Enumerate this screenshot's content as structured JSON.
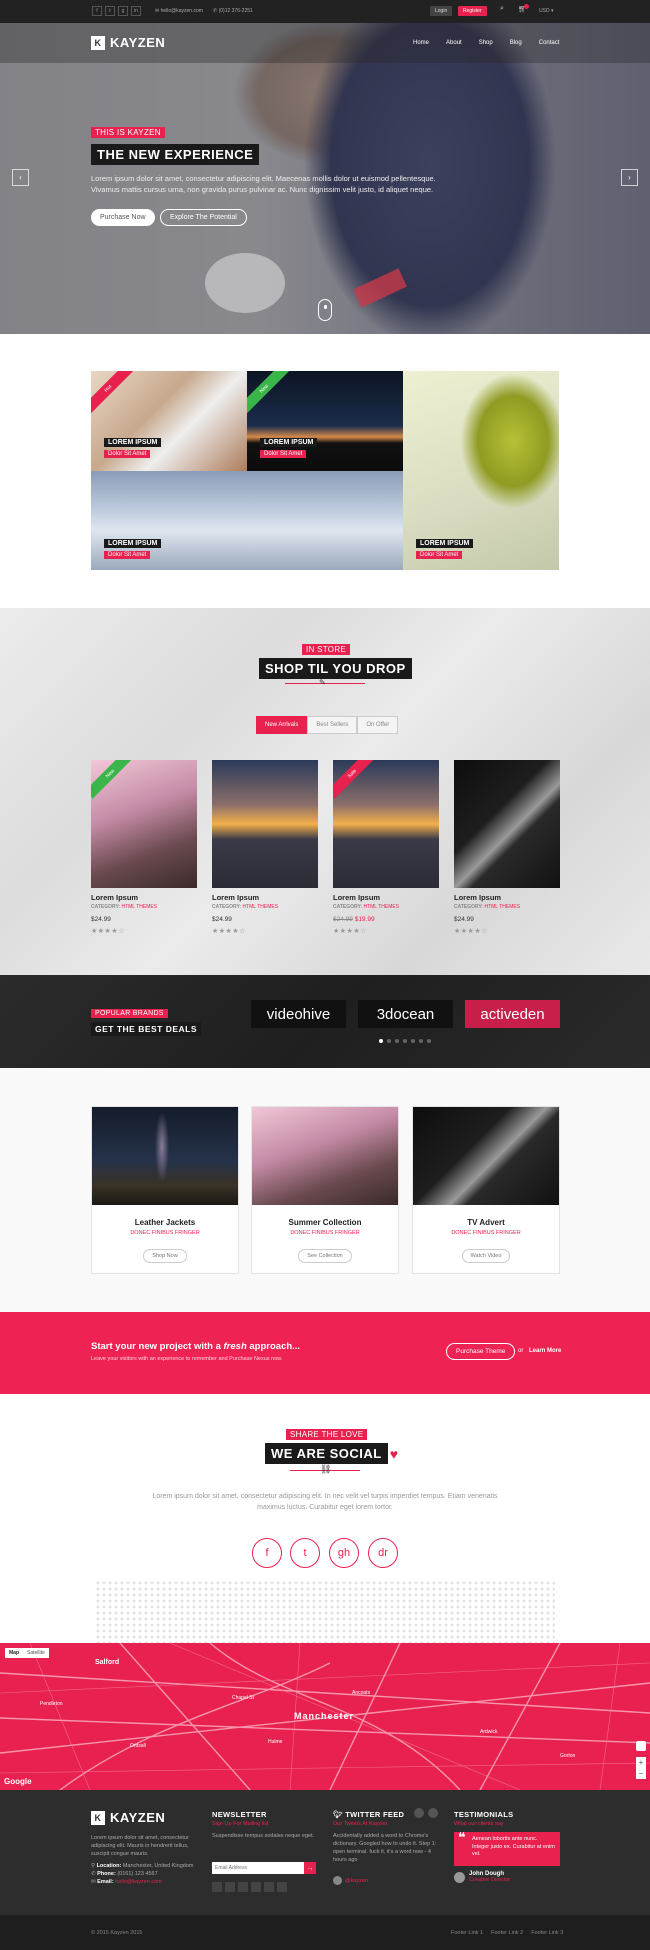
{
  "topbar": {
    "social": [
      "f",
      "t",
      "g",
      "in"
    ],
    "email": "hello@kayzen.com",
    "phone": "(0)12 376-2251",
    "login": "Login",
    "register": "Register",
    "currency": "USD"
  },
  "nav": {
    "logo": "KAYZEN",
    "items": [
      "Home",
      "About",
      "Shop",
      "Blog",
      "Contact"
    ]
  },
  "hero": {
    "tag": "THIS IS KAYZEN",
    "title": "THE NEW EXPERIENCE",
    "text": "Lorem ipsum dolor sit amet, consectetur adipiscing elit. Maecenas mollis dolor ut euismod pellentesque. Vivamus mattis cursus urna, non gravida purus pulvinar ac. Nunc dignissim velit justo, id aliquet neque.",
    "btn_primary": "Purchase Now",
    "btn_secondary": "Explore The Potential"
  },
  "gallery": [
    {
      "title": "LOREM IPSUM",
      "sub": "Dolor Sit Amet",
      "ribbon": "Hot"
    },
    {
      "title": "LOREM IPSUM",
      "sub": "Dolor Sit Amet",
      "ribbon": "New"
    },
    {
      "title": "LOREM IPSUM",
      "sub": "Dolor Sit Amet",
      "ribbon": ""
    },
    {
      "title": "LOREM IPSUM",
      "sub": "Dolor Sit Amet",
      "ribbon": ""
    }
  ],
  "shop": {
    "tag": "IN STORE",
    "title": "SHOP TIL YOU DROP",
    "tabs": [
      "New Arrivals",
      "Best Sellers",
      "On Offer"
    ],
    "products": [
      {
        "name": "Lorem Ipsum",
        "category_label": "CATEGORY:",
        "category": "HTML THEMES",
        "price": "$24.99",
        "old_price": "",
        "ribbon": "New"
      },
      {
        "name": "Lorem Ipsum",
        "category_label": "CATEGORY:",
        "category": "HTML THEMES",
        "price": "$24.99",
        "old_price": "",
        "ribbon": ""
      },
      {
        "name": "Lorem Ipsum",
        "category_label": "CATEGORY:",
        "category": "HTML THEMES",
        "price": "$19.99",
        "old_price": "$24.99",
        "ribbon": "Sale"
      },
      {
        "name": "Lorem Ipsum",
        "category_label": "CATEGORY:",
        "category": "HTML THEMES",
        "price": "$24.99",
        "old_price": "",
        "ribbon": ""
      }
    ],
    "stars": "★★★★☆"
  },
  "brands": {
    "tag": "POPULAR BRANDS",
    "title": "GET THE BEST DEALS",
    "items": [
      "videohive",
      "3docean",
      "activeden"
    ]
  },
  "features": [
    {
      "title": "Leather Jackets",
      "sub": "DONEC FINIBUS FRINGER",
      "btn": "Shop Now"
    },
    {
      "title": "Summer Collection",
      "sub": "DONEC FINIBUS FRINGER",
      "btn": "See Collection"
    },
    {
      "title": "TV Advert",
      "sub": "DONEC FINIBUS FRINGER",
      "btn": "Watch Video"
    }
  ],
  "cta": {
    "title_a": "Start your",
    "title_b": "new",
    "title_c": "project with a",
    "title_d": "fresh",
    "title_e": "approach...",
    "text": "Leave your visitors with an experience to remember and Purchase Nexus now.",
    "btn": "Purchase Theme",
    "or": "or",
    "link": "Learn More"
  },
  "social": {
    "tag": "SHARE THE LOVE",
    "title": "WE ARE SOCIAL",
    "text": "Lorem ipsum dolor sit amet, consectetur adipiscing elit. In nec velit vel turpis imperdiet tempus. Etiam venenatis maximus luctus. Curabitur eget lorem tortor.",
    "icons": [
      "f",
      "t",
      "gh",
      "dr"
    ]
  },
  "map": {
    "city": "Manchester",
    "areas": [
      "Salford",
      "Chapel St",
      "Ancoats",
      "Hulme",
      "Ardwick",
      "Ordsall",
      "Pendleton",
      "Gorton"
    ],
    "map_tab": "Map",
    "sat_tab": "Satellite",
    "google": "Google",
    "zoom_in": "+",
    "zoom_out": "−"
  },
  "footer": {
    "logo": "KAYZEN",
    "about": "Lorem ipsum dolor sit amet, consectetur adipiscing elit. Mauris in hendrerit tellus, suscipit congue mauris.",
    "location_label": "Location:",
    "location": "Manchester, United Kingdom",
    "phone_label": "Phone:",
    "phone": "(0161) 123 4567",
    "email_label": "Email:",
    "email": "hello@kayzen.com",
    "newsletter_title": "NEWSLETTER",
    "newsletter_sub": "Sign Up For Mailing list",
    "newsletter_text": "Suspendisse tempus sodales neque eget.",
    "newsletter_placeholder": "Email Address",
    "newsletter_btn": "→",
    "twitter_title": "TWITTER FEED",
    "twitter_sub": "Our Tweets At Kayzen",
    "tweet": "Accidentally added a word to Chrome's dictionary. Googled how to undo it. Step 1: open terminal. fuck it, it's a word now - 4 hours ago",
    "tweet_user": "@kayzen",
    "testimonials_title": "TESTIMONIALS",
    "testimonials_sub": "What our clients say",
    "quote": "Aenean lobortis ante nunc. Integer justo ex. Curabitur at enim vel.",
    "author": "John Dough",
    "author_role": "Creative Director"
  },
  "bottom": {
    "copyright": "© 2015 Kayzen 2015",
    "links": [
      "Footer Link 1",
      "Footer Link 2",
      "Footer Link 3"
    ]
  },
  "colors": {
    "accent": "#e8214f",
    "dark": "#1a1a1a"
  }
}
